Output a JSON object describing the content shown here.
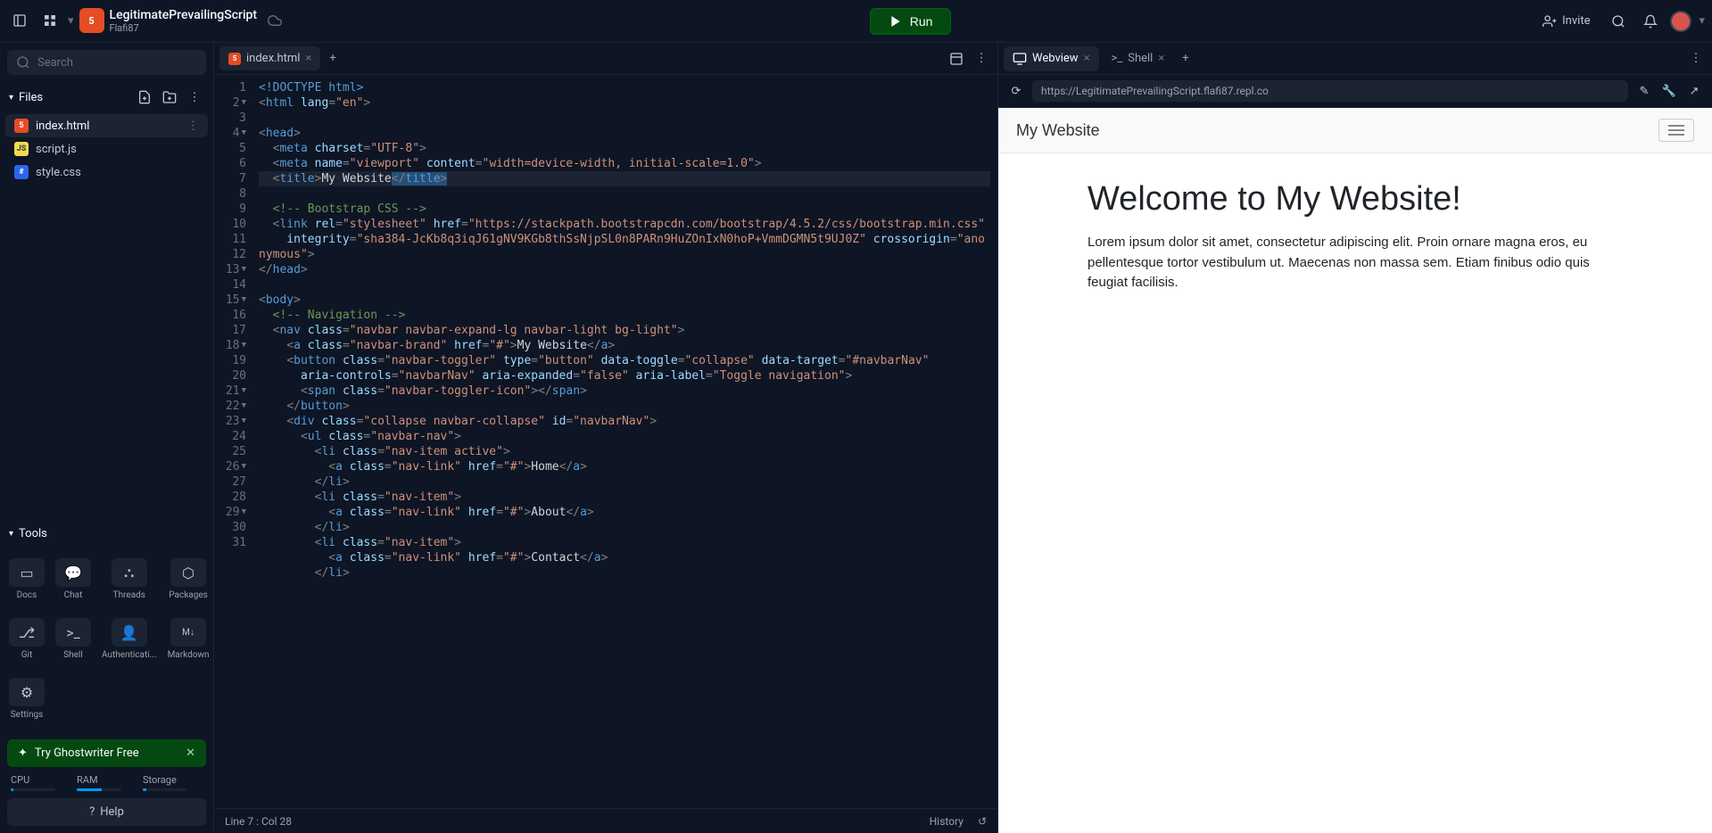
{
  "header": {
    "project_name": "LegitimatePrevailingScript",
    "project_owner": "Flafi87",
    "run_label": "Run",
    "invite_label": "Invite"
  },
  "sidebar": {
    "search_placeholder": "Search",
    "files_label": "Files",
    "tools_label": "Tools",
    "files": [
      {
        "name": "index.html",
        "type": "html"
      },
      {
        "name": "script.js",
        "type": "js"
      },
      {
        "name": "style.css",
        "type": "css"
      }
    ],
    "tools": [
      {
        "name": "Docs"
      },
      {
        "name": "Chat"
      },
      {
        "name": "Threads"
      },
      {
        "name": "Packages"
      },
      {
        "name": "Git"
      },
      {
        "name": "Shell"
      },
      {
        "name": "Authenticati..."
      },
      {
        "name": "Markdown"
      },
      {
        "name": "Settings"
      }
    ],
    "ghostwriter_label": "Try Ghostwriter Free",
    "resources": {
      "cpu": {
        "label": "CPU",
        "pct": 5
      },
      "ram": {
        "label": "RAM",
        "pct": 55
      },
      "storage": {
        "label": "Storage",
        "pct": 8
      }
    },
    "help_label": "Help"
  },
  "editor": {
    "tab_label": "index.html",
    "status_position": "Line 7 : Col 28",
    "status_history": "History",
    "gutter_lines": 31
  },
  "preview": {
    "tabs": {
      "webview": "Webview",
      "shell": "Shell"
    },
    "url": "https://LegitimatePrevailingScript.flafi87.repl.co",
    "page": {
      "brand": "My Website",
      "heading": "Welcome to My Website!",
      "paragraph": "Lorem ipsum dolor sit amet, consectetur adipiscing elit. Proin ornare magna eros, eu pellentesque tortor vestibulum ut. Maecenas non massa sem. Etiam finibus odio quis feugiat facilisis."
    }
  }
}
